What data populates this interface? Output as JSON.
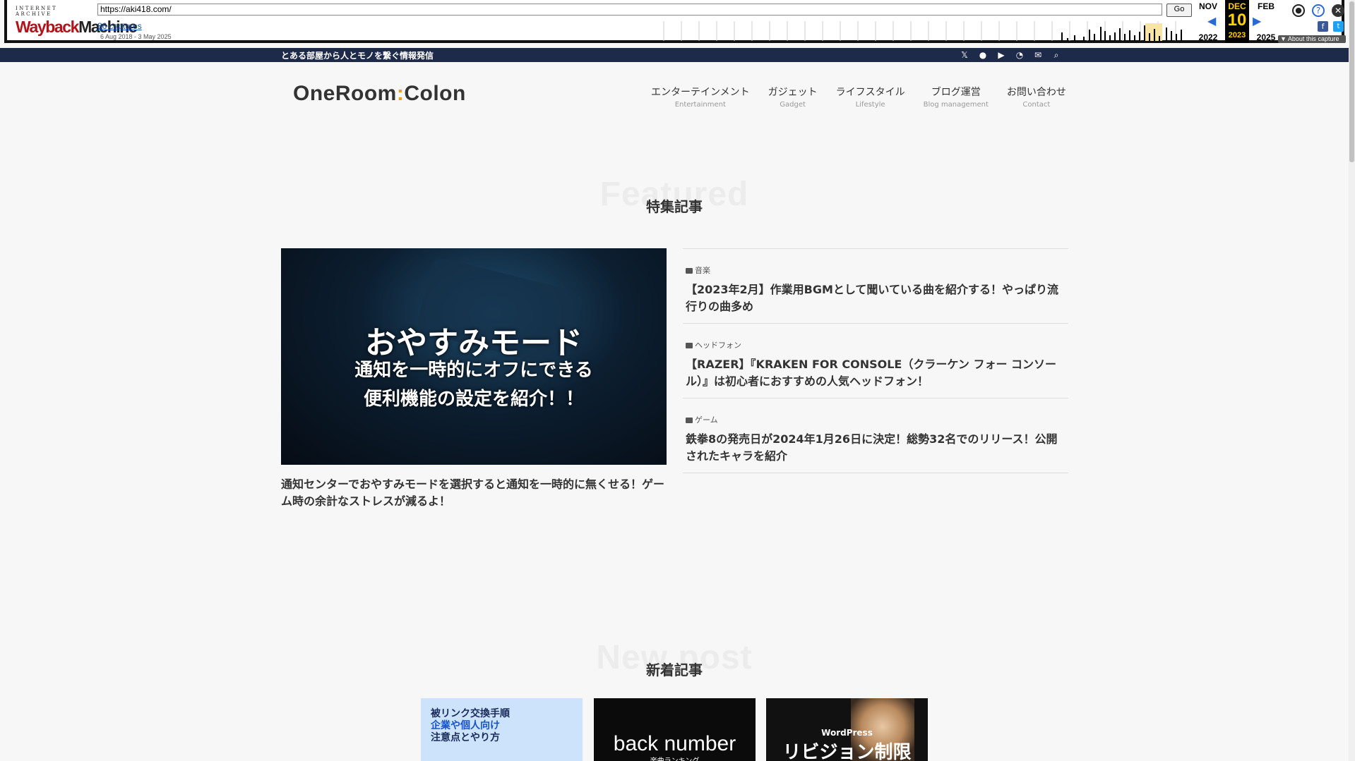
{
  "wayback": {
    "logo_top": "INTERNET ARCHIVE",
    "logo_a": "Wayback",
    "logo_b": "Machine",
    "url": "https://aki418.com/",
    "go_label": "Go",
    "captures": "86 captures",
    "range": "6 Aug 2018 - 3 May 2025",
    "prev_month": "NOV",
    "prev_year": "2022",
    "cur_month": "DEC",
    "cur_day": "10",
    "cur_year": "2023",
    "next_month": "FEB",
    "next_year": "2025",
    "about": "▼ About this capture"
  },
  "topbar": {
    "tagline": "とある部屋から人とモノを繋ぐ情報発信"
  },
  "site": {
    "logo_a": "OneRoom",
    "logo_colon": ":",
    "logo_b": "Colon"
  },
  "nav": [
    {
      "jp": "エンターテインメント",
      "en": "Entertainment"
    },
    {
      "jp": "ガジェット",
      "en": "Gadget"
    },
    {
      "jp": "ライフスタイル",
      "en": "Lifestyle"
    },
    {
      "jp": "ブログ運営",
      "en": "Blog management"
    },
    {
      "jp": "お問い合わせ",
      "en": "Contact"
    }
  ],
  "featured": {
    "bg_label": "Featured",
    "heading": "特集記事",
    "main": {
      "img_line1": "おやすみモード",
      "img_line2": "通知を一時的にオフにできる",
      "img_line3": "便利機能の設定を紹介！！",
      "title": "通知センターでおやすみモードを選択すると通知を一時的に無くせる！ゲーム時の余計なストレスが減るよ！"
    },
    "list": [
      {
        "cat": "音楽",
        "title": "【2023年2月】作業用BGMとして聞いている曲を紹介する！やっぱり流行りの曲多め"
      },
      {
        "cat": "ヘッドフォン",
        "title": "【RAZER】『KRAKEN FOR CONSOLE（クラーケン フォー コンソール）』は初心者におすすめの人気ヘッドフォン！"
      },
      {
        "cat": "ゲーム",
        "title": "鉄拳8の発売日が2024年1月26日に決定！総勢32名でのリリース！公開されたキャラを紹介"
      }
    ]
  },
  "newpost": {
    "bg_label": "New post",
    "heading": "新着記事",
    "cards": [
      {
        "l1": "被リンク交換手順",
        "l2": "企業や個人向け",
        "l3": "注意点とやり方"
      },
      {
        "title": "back number",
        "sub": "楽曲ランキング"
      },
      {
        "sub": "WordPress",
        "title": "リビジョン制限"
      }
    ]
  }
}
